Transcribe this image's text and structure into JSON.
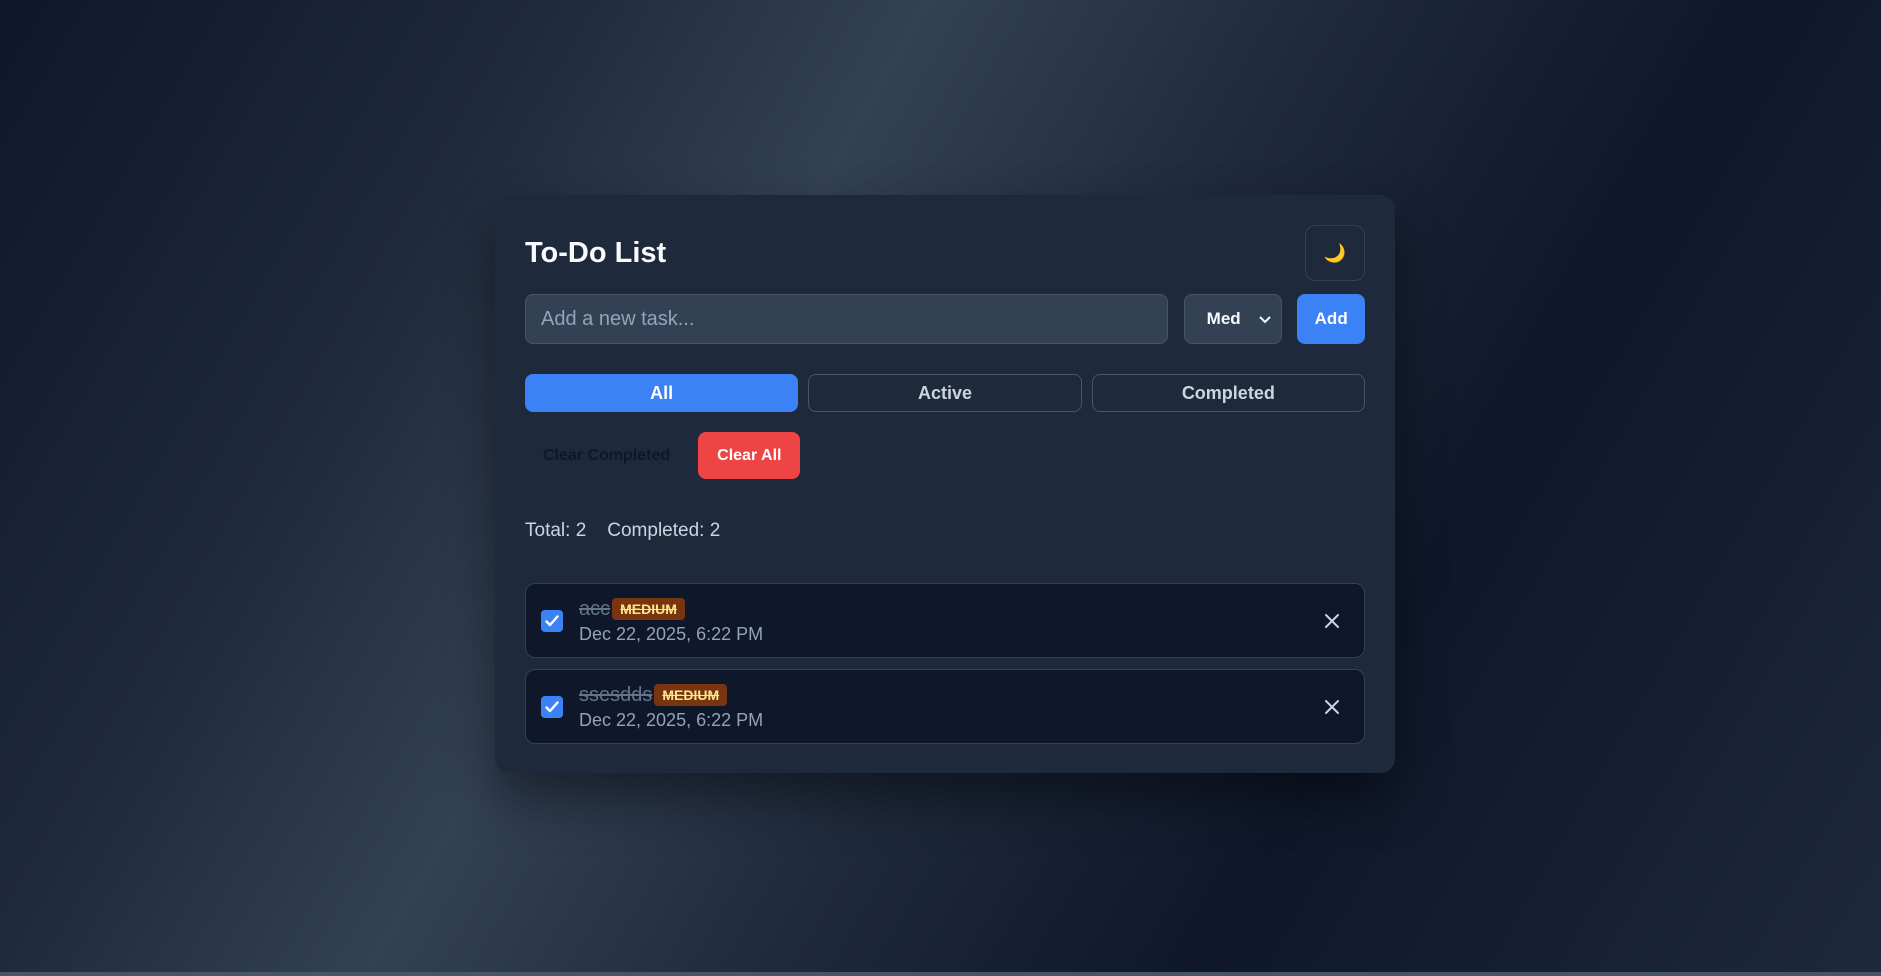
{
  "app": {
    "title": "To-Do List",
    "theme_icon": "moon-icon",
    "theme_glyph": "🌙"
  },
  "new_task": {
    "value": "",
    "placeholder": "Add a new task...",
    "priority_selected": "Med",
    "add_label": "Add"
  },
  "filters": [
    {
      "label": "All",
      "active": true
    },
    {
      "label": "Active",
      "active": false
    },
    {
      "label": "Completed",
      "active": false
    }
  ],
  "actions": {
    "clear_completed_label": "Clear Completed",
    "clear_all_label": "Clear All"
  },
  "stats": {
    "total": "Total: 2",
    "completed": "Completed: 2"
  },
  "tasks": [
    {
      "text": "acc",
      "priority": "MEDIUM",
      "date": "Dec 22, 2025, 6:22 PM",
      "completed": true
    },
    {
      "text": "ssesdds",
      "priority": "MEDIUM",
      "date": "Dec 22, 2025, 6:22 PM",
      "completed": true
    }
  ],
  "colors": {
    "accent": "#3b82f6",
    "danger": "#ef4444",
    "card_bg": "#1e293b",
    "badge_medium_bg": "#78350f",
    "badge_medium_text": "#fde68a"
  }
}
